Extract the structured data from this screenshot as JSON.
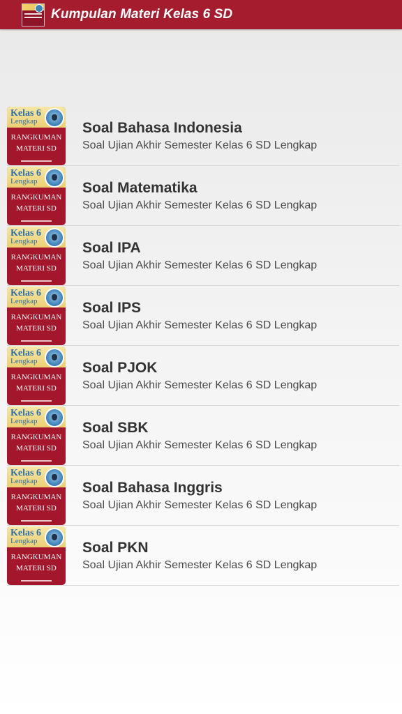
{
  "app_bar": {
    "title": "Kumpulan Materi Kelas 6 SD",
    "background": "#a51c2e",
    "icon": "app-logo-icon"
  },
  "thumbnail": {
    "kelas": "Kelas 6",
    "lengkap": "Lengkap",
    "line1": "RANGKUMAN",
    "line2": "MATERI SD"
  },
  "items": [
    {
      "title": "Soal Bahasa Indonesia",
      "subtitle": "Soal Ujian Akhir Semester Kelas 6 SD Lengkap"
    },
    {
      "title": "Soal Matematika",
      "subtitle": "Soal Ujian Akhir Semester Kelas 6 SD Lengkap"
    },
    {
      "title": "Soal IPA",
      "subtitle": "Soal Ujian Akhir Semester Kelas 6 SD Lengkap"
    },
    {
      "title": "Soal IPS",
      "subtitle": "Soal Ujian Akhir Semester Kelas 6 SD Lengkap"
    },
    {
      "title": "Soal PJOK",
      "subtitle": "Soal Ujian Akhir Semester Kelas 6 SD Lengkap"
    },
    {
      "title": "Soal SBK",
      "subtitle": "Soal Ujian Akhir Semester Kelas 6 SD Lengkap"
    },
    {
      "title": "Soal Bahasa Inggris",
      "subtitle": "Soal Ujian Akhir Semester Kelas 6 SD Lengkap"
    },
    {
      "title": "Soal PKN",
      "subtitle": "Soal Ujian Akhir Semester Kelas 6 SD Lengkap"
    }
  ]
}
